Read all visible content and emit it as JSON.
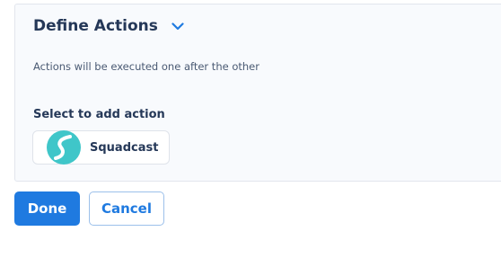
{
  "panel": {
    "title": "Define Actions",
    "collapse_icon": "chevron-down-icon",
    "hint": "Actions will be executed one after the other"
  },
  "actions": {
    "section_label": "Select to add action",
    "items": [
      {
        "label": "Squadcast",
        "icon": "squadcast-logo-icon"
      }
    ]
  },
  "footer": {
    "done_label": "Done",
    "cancel_label": "Cancel"
  },
  "colors": {
    "accent": "#1f7ae0",
    "heading": "#253858",
    "panel_bg": "#f8fafd",
    "logo_teal": "#3fc6c9"
  }
}
